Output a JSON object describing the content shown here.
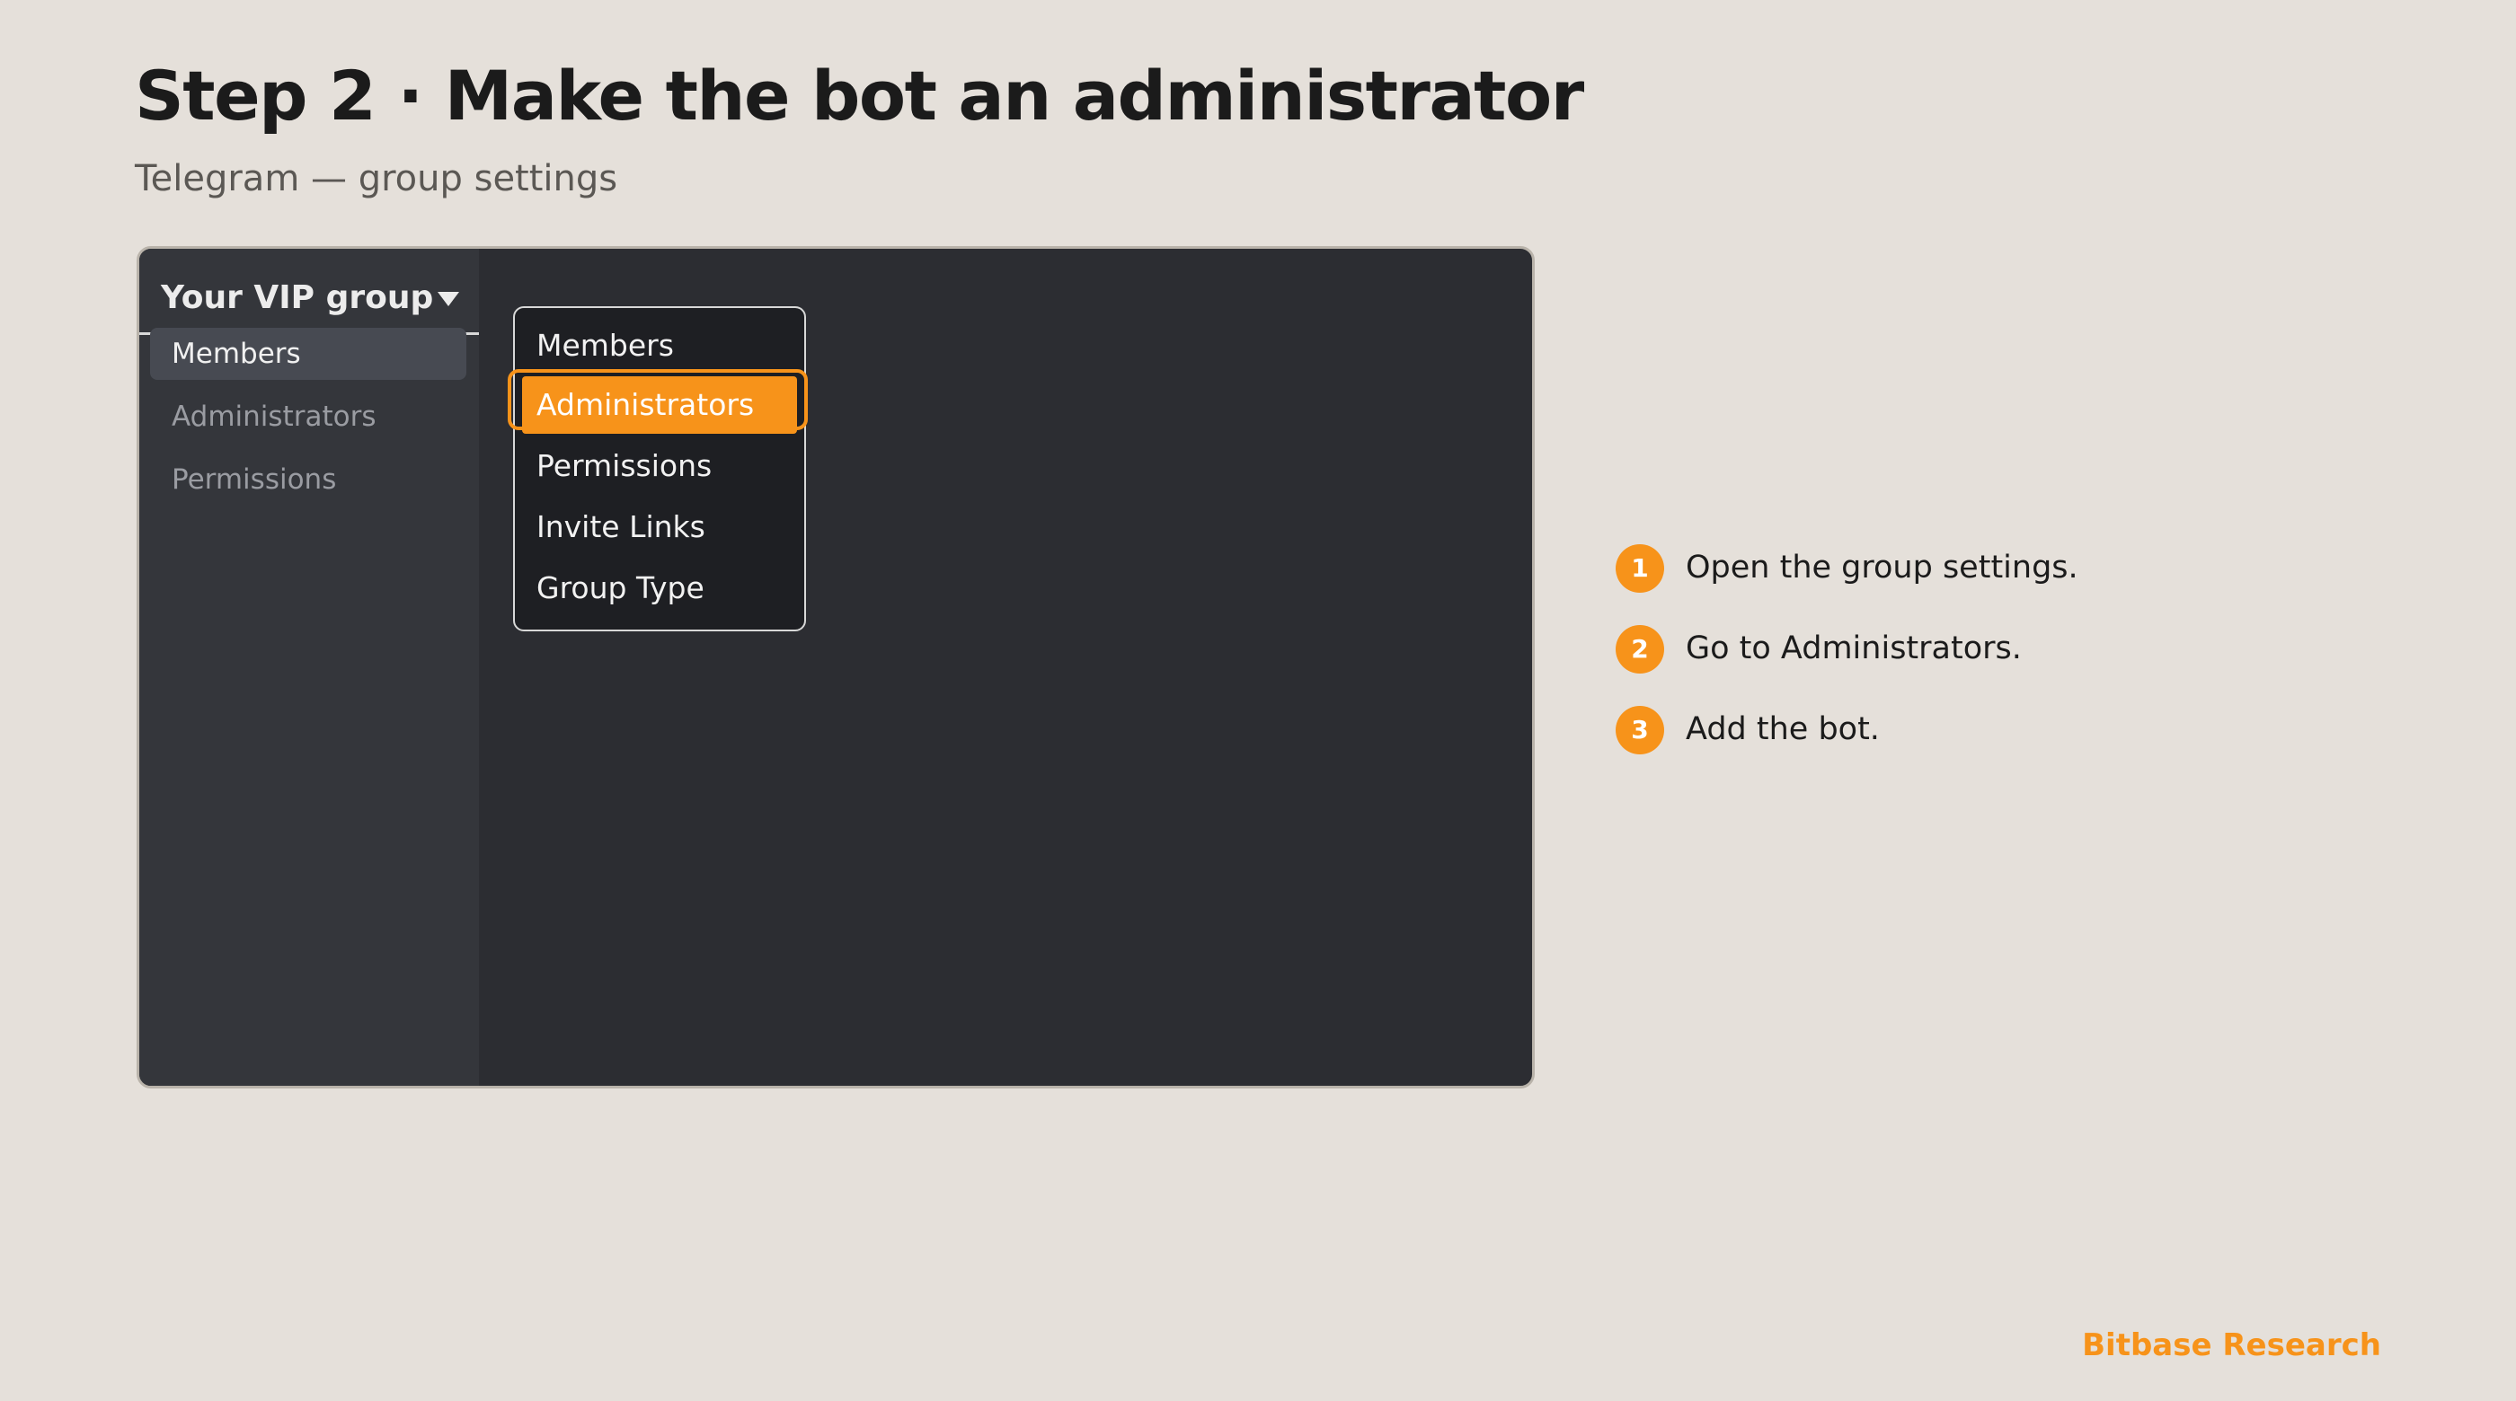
{
  "header": {
    "title": "Step 2 · Make the bot an administrator",
    "subtitle": "Telegram — group settings"
  },
  "window": {
    "sidebar": {
      "group_name": "Your VIP group",
      "group_icon": "chevron-down-icon",
      "items": [
        {
          "label": "Members",
          "active": true
        },
        {
          "label": "Administrators",
          "active": false
        },
        {
          "label": "Permissions",
          "active": false
        }
      ]
    },
    "menu": {
      "items": [
        {
          "label": "Members",
          "selected": false
        },
        {
          "label": "Administrators",
          "selected": true
        },
        {
          "label": "Permissions",
          "selected": false
        },
        {
          "label": "Invite Links",
          "selected": false
        },
        {
          "label": "Group Type",
          "selected": false
        }
      ]
    }
  },
  "steps": [
    {
      "number": "1",
      "text": "Open the group settings."
    },
    {
      "number": "2",
      "text": "Go to Administrators."
    },
    {
      "number": "3",
      "text": "Add the bot."
    }
  ],
  "footer": {
    "brand": "Bitbase Research"
  },
  "colors": {
    "accent": "#f7931a",
    "background": "#e5e0da",
    "window": "#2c2d32",
    "sidebar": "#34363b",
    "menu": "#1e1f23"
  }
}
